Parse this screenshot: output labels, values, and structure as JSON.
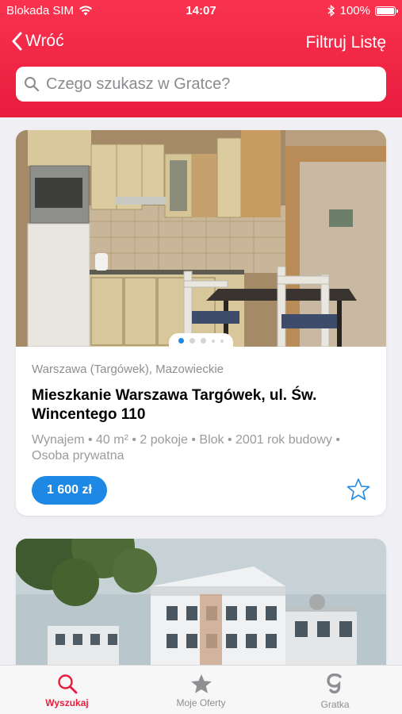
{
  "status_bar": {
    "carrier": "Blokada SIM",
    "time": "14:07",
    "battery": "100%"
  },
  "nav": {
    "back_label": "Wróć",
    "filter_label": "Filtruj Listę"
  },
  "search": {
    "placeholder": "Czego szukasz w Gratce?"
  },
  "listings": [
    {
      "location": "Warszawa (Targówek), Mazowieckie",
      "title": "Mieszkanie Warszawa Targówek, ul. Św. Wincentego 110",
      "details": "Wynajem • 40 m² • 2 pokoje • Blok • 2001 rok budowy • Osoba prywatna",
      "price": "1 600 zł"
    }
  ],
  "tabs": [
    {
      "label": "Wyszukaj",
      "icon": "search-icon",
      "active": true
    },
    {
      "label": "Moje Oferty",
      "icon": "star-icon",
      "active": false
    },
    {
      "label": "Gratka",
      "icon": "gratka-logo-icon",
      "active": false
    }
  ],
  "colors": {
    "brand_red": "#e81c3d",
    "accent_blue": "#1e88e5"
  }
}
